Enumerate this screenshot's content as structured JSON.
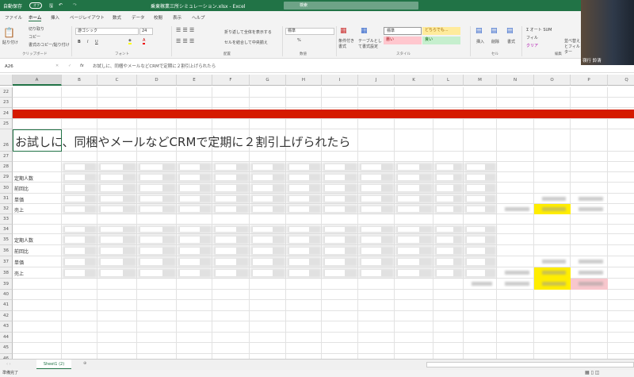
{
  "titlebar": {
    "autosave": "自動保存",
    "autosave_state": "オフ",
    "filename": "乗東稼業三所シミュレーション.xlsx - Excel",
    "search_placeholder": "検索"
  },
  "tabs": [
    "ファイル",
    "ホーム",
    "挿入",
    "ページレイアウト",
    "数式",
    "データ",
    "校閲",
    "表示",
    "ヘルプ"
  ],
  "active_tab": "ホーム",
  "ribbon": {
    "clipboard": {
      "paste": "貼り付け",
      "cut": "切り取り",
      "copy": "コピー",
      "format_painter": "書式のコピー/貼り付け",
      "group": "クリップボード"
    },
    "font": {
      "name": "游ゴシック",
      "size": "24",
      "group": "フォント",
      "bold": "B",
      "italic": "I",
      "underline": "U"
    },
    "alignment": {
      "wrap": "折り返して全体を表示する",
      "merge": "セルを結合して中央揃え",
      "group": "配置"
    },
    "number": {
      "format": "標準",
      "percent": "%",
      "group": "数値"
    },
    "styles": {
      "conditional": "条件付き書式",
      "table": "テーブルとして書式設定",
      "normal": "標準",
      "neutral": "どちらでも...",
      "bad": "悪い",
      "good": "良い",
      "group": "スタイル"
    },
    "cells": {
      "insert": "挿入",
      "delete": "削除",
      "format": "書式",
      "group": "セル"
    },
    "editing": {
      "autosum": "オート SUM",
      "fill": "フィル",
      "clear": "クリア",
      "sort": "並べ替えとフィルター",
      "group": "編集"
    }
  },
  "formula_bar": {
    "name_box": "A26",
    "formula": "お試しに、同梱やメールなどCRMで定期に２割引上げられたら"
  },
  "columns": [
    "A",
    "B",
    "C",
    "D",
    "E",
    "F",
    "G",
    "H",
    "I",
    "J",
    "K",
    "L",
    "M",
    "N",
    "O",
    "P",
    "Q"
  ],
  "rows": [
    "22",
    "23",
    "24",
    "25",
    "26",
    "27",
    "28",
    "29",
    "30",
    "31",
    "32",
    "33",
    "34",
    "35",
    "36",
    "37",
    "38",
    "39",
    "40",
    "41",
    "42",
    "43",
    "44",
    "45",
    "46"
  ],
  "sheet": {
    "heading": "お試しに、同梱やメールなどCRMで定期に２割引上げられたら",
    "block1_labels": [
      "定期人数",
      "前回比",
      "単価",
      "売上"
    ],
    "block2_labels": [
      "定期人数",
      "前回比",
      "単価",
      "売上"
    ]
  },
  "colors": {
    "accent": "#217346",
    "red_band": "#d51a00",
    "highlight": "#ffed00",
    "bad": "#f8c7cd"
  },
  "sheet_tabs": [
    {
      "label": "Sheet1 (2)",
      "active": true
    }
  ],
  "status": "準備完了",
  "webcam": {
    "name": "嶺行 鈴清"
  }
}
